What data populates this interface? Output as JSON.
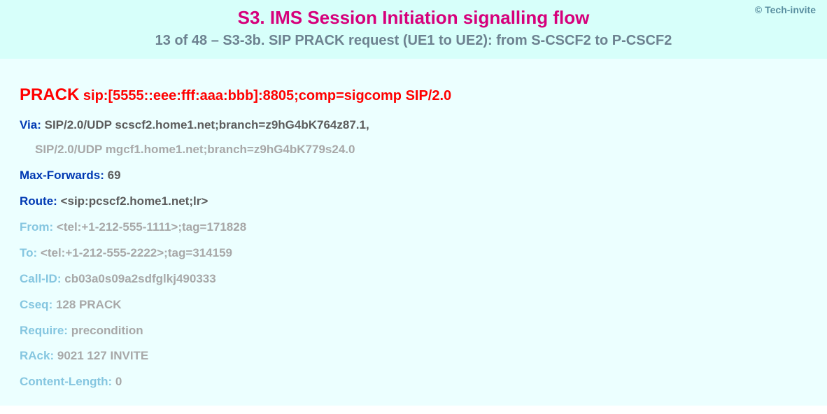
{
  "copyright": "© Tech-invite",
  "title": "S3. IMS Session Initiation signalling flow",
  "subtitle": "13 of 48 – S3-3b. SIP PRACK request (UE1 to UE2): from S-CSCF2 to P-CSCF2",
  "request": {
    "method": "PRACK",
    "uri": "sip:[5555::eee:fff:aaa:bbb]:8805;comp=sigcomp SIP/2.0"
  },
  "headers": {
    "via": {
      "name": "Via:",
      "line1": "SIP/2.0/UDP scscf2.home1.net;branch=z9hG4bK764z87.1,",
      "line2": "SIP/2.0/UDP mgcf1.home1.net;branch=z9hG4bK779s24.0"
    },
    "maxforwards": {
      "name": "Max-Forwards:",
      "value": "69"
    },
    "route": {
      "name": "Route:",
      "value": "<sip:pcscf2.home1.net;lr>"
    },
    "from": {
      "name": "From:",
      "value": "<tel:+1-212-555-1111>;tag=171828"
    },
    "to": {
      "name": "To:",
      "value": "<tel:+1-212-555-2222>;tag=314159"
    },
    "callid": {
      "name": "Call-ID:",
      "value": "cb03a0s09a2sdfglkj490333"
    },
    "cseq": {
      "name": "Cseq:",
      "value": "128 PRACK"
    },
    "require": {
      "name": "Require:",
      "value": "precondition"
    },
    "rack": {
      "name": "RAck:",
      "value": "9021 127 INVITE"
    },
    "contentlength": {
      "name": "Content-Length:",
      "value": "0"
    }
  }
}
